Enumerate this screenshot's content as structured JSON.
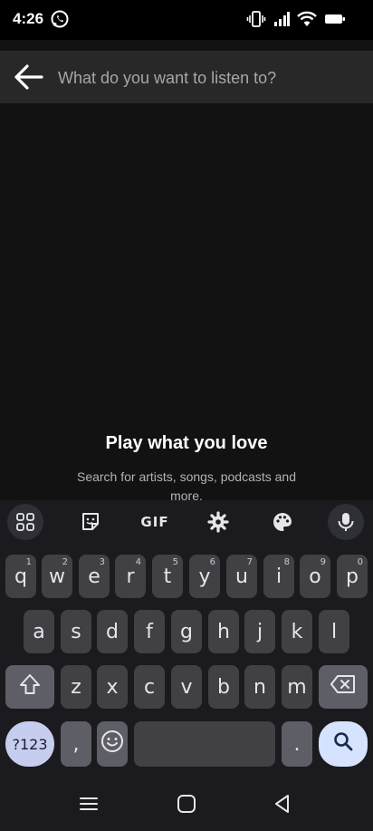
{
  "status_bar": {
    "time": "4:26"
  },
  "search": {
    "placeholder": "What do you want to listen to?",
    "value": ""
  },
  "empty_state": {
    "title": "Play what you love",
    "subtitle": "Search for artists, songs, podcasts and more."
  },
  "keyboard": {
    "toolbar": {
      "gif_label": "GIF"
    },
    "row1": [
      {
        "letter": "q",
        "hint": "1"
      },
      {
        "letter": "w",
        "hint": "2"
      },
      {
        "letter": "e",
        "hint": "3"
      },
      {
        "letter": "r",
        "hint": "4"
      },
      {
        "letter": "t",
        "hint": "5"
      },
      {
        "letter": "y",
        "hint": "6"
      },
      {
        "letter": "u",
        "hint": "7"
      },
      {
        "letter": "i",
        "hint": "8"
      },
      {
        "letter": "o",
        "hint": "9"
      },
      {
        "letter": "p",
        "hint": "0"
      }
    ],
    "row2": [
      "a",
      "s",
      "d",
      "f",
      "g",
      "h",
      "j",
      "k",
      "l"
    ],
    "row3": [
      "z",
      "x",
      "c",
      "v",
      "b",
      "n",
      "m"
    ],
    "bottom": {
      "symbols_label": "?123",
      "comma": ",",
      "period": "."
    }
  },
  "colors": {
    "background": "#121212",
    "search_bar": "#282828",
    "keyboard_bg": "#1b1b1f",
    "key": "#404045",
    "symbols_key": "#c7cdef",
    "search_key": "#d6e3ff"
  }
}
